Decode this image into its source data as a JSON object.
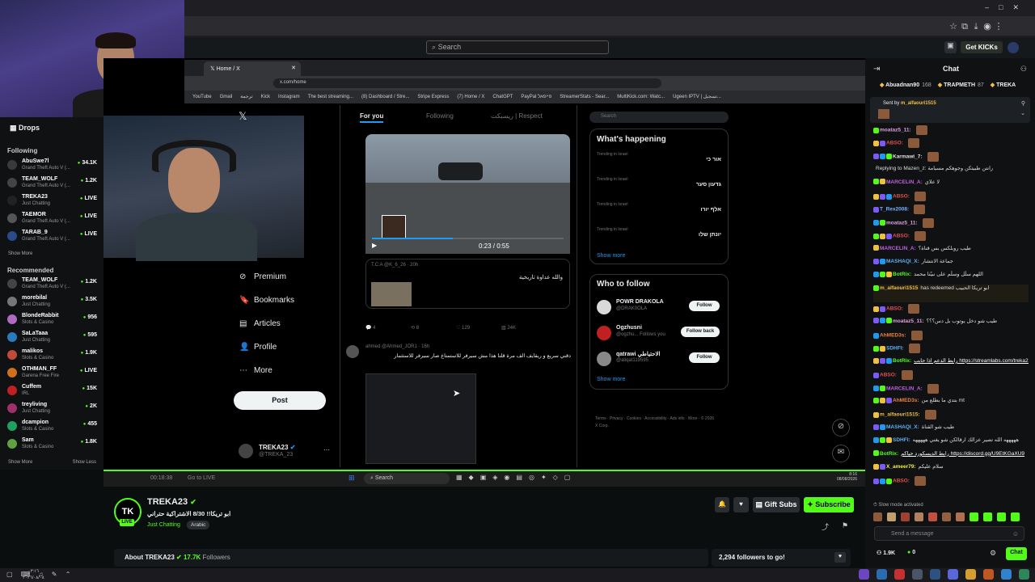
{
  "search_placeholder": "Search",
  "get_kicks": "Get KICKs",
  "sidebar": {
    "drops": "Drops",
    "following_title": "Following",
    "following": [
      {
        "name": "AbuSwe7l",
        "cat": "Grand Theft Auto V (...",
        "viewers": "34.1K",
        "color": "#3a3a3a"
      },
      {
        "name": "TEAM_WOLF",
        "cat": "Grand Theft Auto V (...",
        "viewers": "1.2K",
        "color": "#444"
      },
      {
        "name": "TREKA23",
        "cat": "Just Chatting",
        "viewers": "LIVE",
        "color": "#222"
      },
      {
        "name": "TAEMOR",
        "cat": "Grand Theft Auto V (...",
        "viewers": "LIVE",
        "color": "#555"
      },
      {
        "name": "TARAB_9",
        "cat": "Grand Theft Auto V (...",
        "viewers": "LIVE",
        "color": "#2a4a8a"
      }
    ],
    "show_more": "Show More",
    "recommended_title": "Recommended",
    "recommended": [
      {
        "name": "TEAM_WOLF",
        "cat": "Grand Theft Auto V (...",
        "viewers": "1.2K",
        "color": "#444"
      },
      {
        "name": "morebilal",
        "cat": "Just Chatting",
        "viewers": "3.5K",
        "color": "#777"
      },
      {
        "name": "BlondeRabbit",
        "cat": "Slots & Casino",
        "viewers": "956",
        "color": "#b06ac0"
      },
      {
        "name": "SaLaTaaa",
        "cat": "Just Chatting",
        "viewers": "595",
        "color": "#2a7abf"
      },
      {
        "name": "malikos",
        "cat": "Slots & Casino",
        "viewers": "1.9K",
        "color": "#c04a3a"
      },
      {
        "name": "OTHMAN_FF",
        "cat": "Garena Free Fire",
        "viewers": "LIVE",
        "color": "#d0701a"
      },
      {
        "name": "Cuffem",
        "cat": "IRL",
        "viewers": "15K",
        "color": "#c02020"
      },
      {
        "name": "treyliving",
        "cat": "Just Chatting",
        "viewers": "2K",
        "color": "#a0306a"
      },
      {
        "name": "dcampion",
        "cat": "Slots & Casino",
        "viewers": "455",
        "color": "#20a060"
      },
      {
        "name": "Sam",
        "cat": "Slots & Casino",
        "viewers": "1.8K",
        "color": "#60a040"
      }
    ],
    "show_more2": "Show More",
    "show_less": "Show Less"
  },
  "inner_browser": {
    "tab_title": "Home / X",
    "url": "x.com/home",
    "bookmarks": [
      "YouTube",
      "Gmail",
      "ترجمة",
      "Kick",
      "Instagram",
      "The best streaming...",
      "(8) Dashboard / Stre...",
      "Stripe Express",
      "(7) Home / X",
      "ChatGPT",
      "PayPal פייפאל",
      "StreamerStats - Sear...",
      "MultiKick.com: Watc...",
      "Ugeen IPTV | تسجيل..."
    ]
  },
  "x_nav": {
    "items": [
      {
        "icon": "⊘",
        "label": "Premium",
        "name": "premium"
      },
      {
        "icon": "🔖",
        "label": "Bookmarks",
        "name": "bookmarks"
      },
      {
        "icon": "▤",
        "label": "Articles",
        "name": "articles"
      },
      {
        "icon": "👤",
        "label": "Profile",
        "name": "profile"
      },
      {
        "icon": "⋯",
        "label": "More",
        "name": "more"
      }
    ],
    "post": "Post",
    "account_name": "TREKA23",
    "account_handle": "@TREKA_23"
  },
  "feed": {
    "tab_for_you": "For you",
    "tab_following": "Following",
    "tab_other": "ريسبكت | Respect",
    "video_time": "0:23 / 0:55",
    "quote_author": "T.C.A @K_6_26 · 20h",
    "quote_text": "والله عداوة تاريخية",
    "stats": [
      "4",
      "8",
      "129",
      "24K"
    ],
    "post2_author": "ahmed @Ahmed_JOR1 · 16h",
    "post2_text": "دقني سريع و ريقايف الف مرة قلنا هذا مش سيرفر للاستمتاع صار سيرفر للاستثمار"
  },
  "trends": {
    "search": "Search",
    "title": "What's happening",
    "items": [
      {
        "label": "Trending in Israel",
        "value": "אור כי"
      },
      {
        "label": "Trending in Israel",
        "value": "גדעון סער"
      },
      {
        "label": "Trending in Israel",
        "value": "אלף יורו"
      },
      {
        "label": "Trending in Israel",
        "value": "יונתן שלו"
      }
    ],
    "show_more": "Show more"
  },
  "who": {
    "title": "Who to follow",
    "items": [
      {
        "name": "POWR DRAKOLA",
        "handle": "@DRAK0OLA",
        "btn": "Follow",
        "color": "#d9d9d9"
      },
      {
        "name": "Ogzhusni",
        "handle": "@ogzhu... Follows you",
        "btn": "Follow back",
        "color": "#c02020"
      },
      {
        "name": "qatrawi الاحتياطي",
        "handle": "@aliqat119595",
        "btn": "Follow",
        "color": "#888"
      }
    ],
    "show_more": "Show more",
    "footer": "Terms · Privacy · Cookies · Accessibility · Ads info · More · © 2026 X Corp."
  },
  "stream_bar": {
    "time": "00:18:38",
    "go_live": "Go to LIVE",
    "search": "Search",
    "clock": "8:16",
    "date": "08/08/2026"
  },
  "channel": {
    "logo": "TK",
    "live": "LIVE",
    "name": "TREKA23",
    "title": "ابو تريكا!! 8/30 الاشتراكية حتراني",
    "category": "Just Chatting",
    "tag": "Arabic",
    "gift": "Gift Subs",
    "subscribe": "Subscribe",
    "about": "About TREKA23",
    "followers_count": "17.7K",
    "followers_label": "Followers",
    "goal": "2,294 followers to go!"
  },
  "chat": {
    "title": "Chat",
    "top_users": [
      {
        "name": "Abuadnan90",
        "pts": "168"
      },
      {
        "name": "TRAPMETH",
        "pts": "87"
      },
      {
        "name": "TREKA",
        "pts": ""
      }
    ],
    "sent_by": "Sent by",
    "sent_user": "m_alfaouri1515",
    "messages": [
      {
        "user": "moataz5_11:",
        "color": "#e0a0e0",
        "text": ""
      },
      {
        "user": "ABSO:",
        "color": "#e05050",
        "text": ""
      },
      {
        "user": "Karmawi_7:",
        "color": "#e0e0e0",
        "text": ""
      },
      {
        "user": "",
        "color": "#aaa",
        "text": "Replying to Mazen_z: رانتن طبيتكن وجوهكم مسيامة"
      },
      {
        "user": "MARCELIN_A:",
        "color": "#c060e0",
        "text": "لا علاي"
      },
      {
        "user": "ABSO:",
        "color": "#e05050",
        "text": ""
      },
      {
        "user": "T_Rex2008:",
        "color": "#7ab0ff",
        "text": ""
      },
      {
        "user": "moataz5_11:",
        "color": "#e0a0e0",
        "text": ""
      },
      {
        "user": "ABSO:",
        "color": "#e05050",
        "text": ""
      },
      {
        "user": "MARCELIN_A:",
        "color": "#c060e0",
        "text": "طيب روبلكس بس قناة؟"
      },
      {
        "user": "MASHAQI_X:",
        "color": "#60b0f0",
        "text": "جماعة الانتشار"
      },
      {
        "user": "BotRix:",
        "color": "#53fc18",
        "text": "اللهم سلّل وسلّم على نبيّنا محمد"
      },
      {
        "user": "m_alfaouri1515",
        "color": "#f0c040",
        "text": "has redeemed ابو تريكا الحبيب"
      },
      {
        "user": "ABSO:",
        "color": "#e05050",
        "text": ""
      },
      {
        "user": "moataz5_11:",
        "color": "#e0a0e0",
        "text": "طيب شو دخل يوتوب بل دس؟؟؟"
      },
      {
        "user": "AhMED3s:",
        "color": "#f08040",
        "text": ""
      },
      {
        "user": "SDHFI:",
        "color": "#60b0f0",
        "text": ""
      },
      {
        "user": "BotRix:",
        "color": "#53fc18",
        "text": "رابط الدعم اذا حابب https://streamlabs.com/treka23/tip"
      },
      {
        "user": "ABSO:",
        "color": "#e05050",
        "text": ""
      },
      {
        "user": "MARCELIN_A:",
        "color": "#c060e0",
        "text": ""
      },
      {
        "user": "AhMED3s:",
        "color": "#f08040",
        "text": "بتدي ما بطلع من mt"
      },
      {
        "user": "m_alfaouri1515:",
        "color": "#f0c040",
        "text": ""
      },
      {
        "user": "MASHAQI_X:",
        "color": "#60b0f0",
        "text": "طيب شو القناة"
      },
      {
        "user": "SDHFI:",
        "color": "#60b0f0",
        "text": "هههههه الله تصير عزالك ارقالكن شو يغني هههههه"
      },
      {
        "user": "BotRix:",
        "color": "#53fc18",
        "text": "رابط الديسكورد حياكم https://discord.gg/U9EtKGaXU9"
      },
      {
        "user": "X_ameer79:",
        "color": "#f0f040",
        "text": "سلام عليكم"
      },
      {
        "user": "ABSO:",
        "color": "#e05050",
        "text": ""
      }
    ],
    "slow_mode": "Slow mode activated",
    "input_placeholder": "Send a message",
    "followers": "1.9K",
    "kicks": "0",
    "chat_button": "Chat"
  },
  "os": {
    "time": "٠٣:١٦",
    "date": "٢٠٢٦/٠٨/٠٨"
  }
}
